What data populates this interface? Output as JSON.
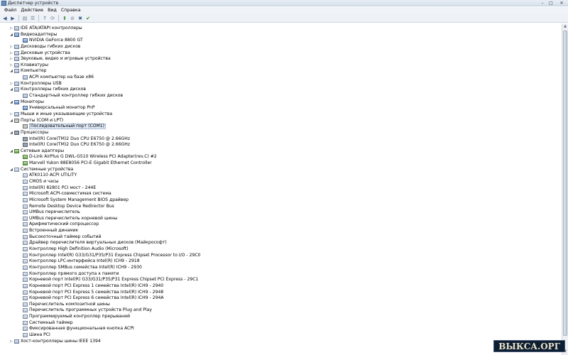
{
  "window": {
    "title": "Диспетчер устройств",
    "icon": "device-manager-icon"
  },
  "menu": [
    "Файл",
    "Действие",
    "Вид",
    "Справка"
  ],
  "toolbar": [
    "back-arrow-icon",
    "forward-arrow-icon",
    "sep",
    "properties-icon",
    "list-icon",
    "sep",
    "help-icon",
    "scan-icon",
    "sep",
    "update-driver-icon",
    "disable-icon",
    "uninstall-icon",
    "enable-icon"
  ],
  "tree": [
    {
      "level": 1,
      "toggle": "collapsed",
      "icon": "ide-icon",
      "label": "IDE ATA/ATAPI контроллеры"
    },
    {
      "level": 1,
      "toggle": "expanded",
      "icon": "display-adapter-icon",
      "label": "Видеоадаптеры"
    },
    {
      "level": 2,
      "toggle": "none",
      "icon": "display-adapter-icon",
      "label": "NVIDIA GeForce 8800 GT"
    },
    {
      "level": 1,
      "toggle": "collapsed",
      "icon": "floppy-drive-icon",
      "label": "Дисководы гибких дисков"
    },
    {
      "level": 1,
      "toggle": "collapsed",
      "icon": "disk-drive-icon",
      "label": "Дисковые устройства"
    },
    {
      "level": 1,
      "toggle": "collapsed",
      "icon": "sound-icon",
      "label": "Звуковые, видео и игровые устройства"
    },
    {
      "level": 1,
      "toggle": "collapsed",
      "icon": "keyboard-icon",
      "label": "Клавиатуры"
    },
    {
      "level": 1,
      "toggle": "expanded",
      "icon": "computer-icon",
      "label": "Компьютер"
    },
    {
      "level": 2,
      "toggle": "none",
      "icon": "computer-icon",
      "label": "ACPI компьютер на базе x86"
    },
    {
      "level": 1,
      "toggle": "collapsed",
      "icon": "usb-icon",
      "label": "Контроллеры USB"
    },
    {
      "level": 1,
      "toggle": "expanded",
      "icon": "floppy-controller-icon",
      "label": "Контроллеры гибких дисков"
    },
    {
      "level": 2,
      "toggle": "none",
      "icon": "floppy-controller-icon",
      "label": "Стандартный контроллер гибких дисков"
    },
    {
      "level": 1,
      "toggle": "expanded",
      "icon": "monitor-icon",
      "label": "Мониторы"
    },
    {
      "level": 2,
      "toggle": "none",
      "icon": "monitor-icon",
      "label": "Универсальный монитор PnP"
    },
    {
      "level": 1,
      "toggle": "collapsed",
      "icon": "mouse-icon",
      "label": "Мыши и иные указывающие устройства"
    },
    {
      "level": 1,
      "toggle": "expanded",
      "icon": "port-icon",
      "label": "Порты (COM и LPT)"
    },
    {
      "level": 2,
      "toggle": "none",
      "icon": "port-icon",
      "label": "Последовательный порт (COM1)",
      "selected": true
    },
    {
      "level": 1,
      "toggle": "expanded",
      "icon": "processor-icon",
      "label": "Процессоры"
    },
    {
      "level": 2,
      "toggle": "none",
      "icon": "processor-icon",
      "label": "Intel(R) Core(TM)2 Duo CPU      E6750  @ 2.66GHz"
    },
    {
      "level": 2,
      "toggle": "none",
      "icon": "processor-icon",
      "label": "Intel(R) Core(TM)2 Duo CPU      E6750  @ 2.66GHz"
    },
    {
      "level": 1,
      "toggle": "expanded",
      "icon": "network-adapter-icon",
      "label": "Сетевые адаптеры"
    },
    {
      "level": 2,
      "toggle": "none",
      "icon": "network-adapter-icon",
      "label": "D-Link AirPlus G DWL-G510 Wireless PCI Adapter(rev.C) #2"
    },
    {
      "level": 2,
      "toggle": "none",
      "icon": "network-adapter-icon",
      "label": "Marvell Yukon 88E8056 PCI-E Gigabit Ethernet Controller"
    },
    {
      "level": 1,
      "toggle": "expanded",
      "icon": "system-device-icon",
      "label": "Системные устройства"
    },
    {
      "level": 2,
      "toggle": "none",
      "icon": "system-device-icon",
      "label": "ATK0110 ACPI UTILITY"
    },
    {
      "level": 2,
      "toggle": "none",
      "icon": "system-device-icon",
      "label": "CMOS и часы"
    },
    {
      "level": 2,
      "toggle": "none",
      "icon": "system-device-icon",
      "label": "Intel(R) 82801 PCI мост - 244E"
    },
    {
      "level": 2,
      "toggle": "none",
      "icon": "system-device-icon",
      "label": "Microsoft ACPI-совместимая система"
    },
    {
      "level": 2,
      "toggle": "none",
      "icon": "system-device-icon",
      "label": "Microsoft System Management BIOS драйвер"
    },
    {
      "level": 2,
      "toggle": "none",
      "icon": "system-device-icon",
      "label": "Remote Desktop Device Redirector Bus"
    },
    {
      "level": 2,
      "toggle": "none",
      "icon": "system-device-icon",
      "label": "UMBus перечислитель"
    },
    {
      "level": 2,
      "toggle": "none",
      "icon": "system-device-icon",
      "label": "UMBus перечислитель корневой шины"
    },
    {
      "level": 2,
      "toggle": "none",
      "icon": "system-device-icon",
      "label": "Арифметический сопроцессор"
    },
    {
      "level": 2,
      "toggle": "none",
      "icon": "system-device-icon",
      "label": "Встроенный динамик"
    },
    {
      "level": 2,
      "toggle": "none",
      "icon": "system-device-icon",
      "label": "Высокоточный таймер событий"
    },
    {
      "level": 2,
      "toggle": "none",
      "icon": "system-device-icon",
      "label": "Драйвер перечислителя виртуальных дисков (Майкрософт)"
    },
    {
      "level": 2,
      "toggle": "none",
      "icon": "system-device-icon",
      "label": "Контроллер High Definition Audio (Microsoft)"
    },
    {
      "level": 2,
      "toggle": "none",
      "icon": "system-device-icon",
      "label": "Контроллер Intel(R) G33/G31/P35/P31 Express Chipset Processor to I/O - 29C0"
    },
    {
      "level": 2,
      "toggle": "none",
      "icon": "system-device-icon",
      "label": "Контроллер LPC-интерфейса Intel(R) ICH9 - 2918"
    },
    {
      "level": 2,
      "toggle": "none",
      "icon": "system-device-icon",
      "label": "Контроллер SMBus семейства Intel(R) ICH9 - 2930"
    },
    {
      "level": 2,
      "toggle": "none",
      "icon": "system-device-icon",
      "label": "Контроллер прямого доступа к памяти"
    },
    {
      "level": 2,
      "toggle": "none",
      "icon": "system-device-icon",
      "label": "Корневой порт Intel(R) G33/G31/P35/P31 Express Chipset PCI Express - 29C1"
    },
    {
      "level": 2,
      "toggle": "none",
      "icon": "system-device-icon",
      "label": "Корневой порт PCI Express 1 семейства Intel(R) ICH9 - 2940"
    },
    {
      "level": 2,
      "toggle": "none",
      "icon": "system-device-icon",
      "label": "Корневой порт PCI Express 5 семейства Intel(R) ICH9 - 2948"
    },
    {
      "level": 2,
      "toggle": "none",
      "icon": "system-device-icon",
      "label": "Корневой порт PCI Express 6 семейства Intel(R) ICH9 - 294A"
    },
    {
      "level": 2,
      "toggle": "none",
      "icon": "system-device-icon",
      "label": "Перечислитель композитной шины"
    },
    {
      "level": 2,
      "toggle": "none",
      "icon": "system-device-icon",
      "label": "Перечислитель программных устройств Plug and Play"
    },
    {
      "level": 2,
      "toggle": "none",
      "icon": "system-device-icon",
      "label": "Программируемый контроллер прерываний"
    },
    {
      "level": 2,
      "toggle": "none",
      "icon": "system-device-icon",
      "label": "Системный таймер"
    },
    {
      "level": 2,
      "toggle": "none",
      "icon": "system-device-icon",
      "label": "Фиксированная функциональная кнопка ACPI"
    },
    {
      "level": 2,
      "toggle": "none",
      "icon": "system-device-icon",
      "label": "Шина PCI"
    },
    {
      "level": 1,
      "toggle": "collapsed",
      "icon": "ieee1394-icon",
      "label": "Хост-контроллеры шины IEEE 1394"
    }
  ],
  "watermark": "ВЫКСА.ОРГ"
}
